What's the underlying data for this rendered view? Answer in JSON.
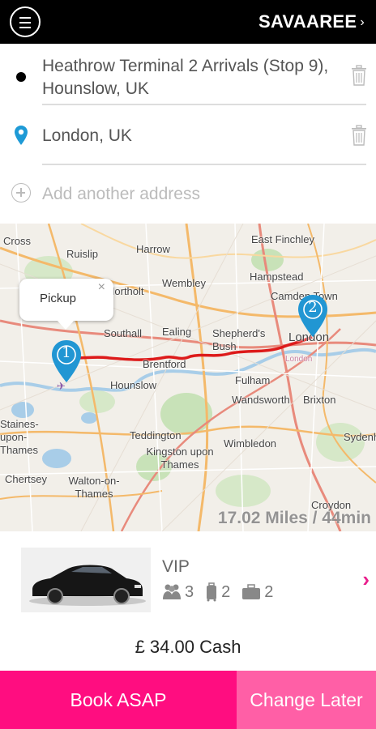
{
  "header": {
    "brand": "SAVAAREE",
    "brand_chevron": "›",
    "menu_icon": "hamburger-menu-icon"
  },
  "addresses": {
    "pickup": "Heathrow Terminal 2 Arrivals (Stop 9), Hounslow, UK",
    "dropoff": "London, UK",
    "add_placeholder": "Add another address"
  },
  "map": {
    "popup_label": "Pickup",
    "popup_close": "×",
    "marker_start": "1",
    "marker_end": "2",
    "distance": "17.02 Miles / 44min",
    "route_color": "#dd1a1a",
    "marker_color": "#2196d3",
    "places": [
      "Cross",
      "Ruislip",
      "Harrow",
      "East Finchley",
      "Wembley",
      "Hampstead",
      "Northolt",
      "Camden Town",
      "Southall",
      "Ealing",
      "Shepherd's Bush",
      "London",
      "London",
      "Brentford",
      "Hounslow",
      "Fulham",
      "Wandsworth",
      "Brixton",
      "Sydenh",
      "Staines-upon-Thames",
      "Teddington",
      "Kingston upon Thames",
      "Wimbledon",
      "Chertsey",
      "Walton-on-Thames",
      "Croydon"
    ]
  },
  "vehicle": {
    "type": "VIP",
    "passengers": "3",
    "luggage": "2",
    "hand_luggage": "2",
    "next": "›"
  },
  "fare": {
    "price": "£ 34.00 Cash"
  },
  "actions": {
    "book": "Book ASAP",
    "later": "Change Later"
  },
  "colors": {
    "accent": "#ff0d80",
    "accent_light": "#ff5fa6",
    "header": "#000000"
  }
}
